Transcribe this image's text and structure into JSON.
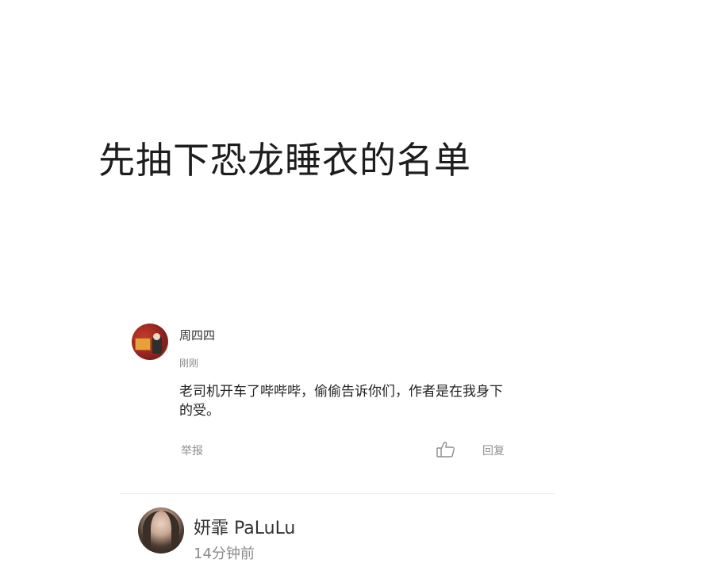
{
  "headline": "先抽下恐龙睡衣的名单",
  "comments": [
    {
      "username": "周四四",
      "time": "刚刚",
      "text": "老司机开车了哔哔哔，偷偷告诉你们，作者是在我身下的受。",
      "report_label": "举报",
      "reply_label": "回复",
      "like_icon": "thumbs-up-icon"
    },
    {
      "username": "妍霏 PaLuLu",
      "time": "14分钟前"
    }
  ],
  "colors": {
    "text": "#222222",
    "muted": "#8a8a8a",
    "divider": "#ececec"
  }
}
